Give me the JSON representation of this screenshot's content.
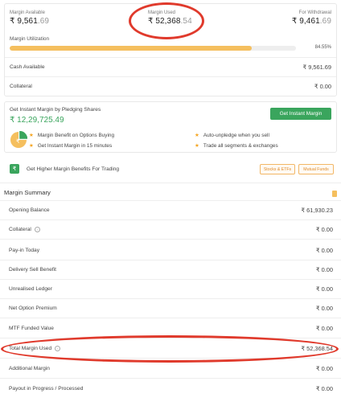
{
  "top": {
    "margin_available": {
      "label": "Margin Available",
      "main": "₹ 9,561",
      "dec": ".69"
    },
    "margin_used": {
      "label": "Margin Used",
      "main": "₹ 52,368",
      "dec": ".54"
    },
    "for_withdrawal": {
      "label": "For Withdrawal",
      "main": "₹ 9,461",
      "dec": ".69"
    },
    "utilization_label": "Margin Utilization",
    "utilization_pct_text": "84.55%",
    "utilization_fraction": 0.8455,
    "cash_available_label": "Cash Available",
    "cash_available_value": "₹ 9,561.69",
    "collateral_label": "Collateral",
    "collateral_value": "₹ 0.00"
  },
  "pledge": {
    "title": "Get Instant Margin by Pledging Shares",
    "amount": "₹ 12,29,725.49",
    "button": "Get Instant Margin",
    "features": [
      "Margin Benefit on Options Buying",
      "Get Instant Margin in 15 minutes",
      "Auto-unpledge when you sell",
      "Trade all segments & exchanges"
    ]
  },
  "benefits": {
    "text": "Get Higher Margin Benefits For Trading",
    "chips": [
      "Stocks & ETFs",
      "Mutual Funds"
    ]
  },
  "summary": {
    "title": "Margin Summary",
    "rows": [
      {
        "label": "Opening Balance",
        "value": "₹ 61,930.23"
      },
      {
        "label": "Collateral",
        "value": "₹ 0.00"
      },
      {
        "label": "Pay-in Today",
        "value": "₹ 0.00"
      },
      {
        "label": "Delivery Sell Benefit",
        "value": "₹ 0.00"
      },
      {
        "label": "Unrealised Ledger",
        "value": "₹ 0.00"
      },
      {
        "label": "Net Option Premium",
        "value": "₹ 0.00"
      },
      {
        "label": "MTF Funded Value",
        "value": "₹ 0.00"
      },
      {
        "label": "Total Margin Used",
        "value": "₹ 52,368.54"
      },
      {
        "label": "Additional Margin",
        "value": "₹ 0.00"
      },
      {
        "label": "Payout in Progress / Processed",
        "value": "₹ 0.00"
      }
    ]
  },
  "colors": {
    "accent_green": "#3aa55d",
    "bar_orange": "#f5bf5e",
    "annotation_red": "#e03a2c"
  }
}
